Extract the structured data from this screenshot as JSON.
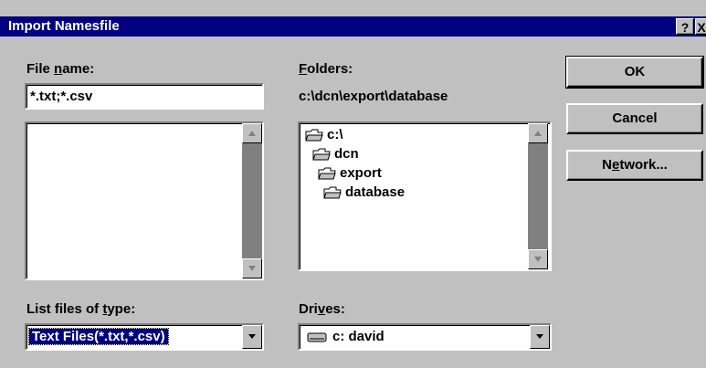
{
  "dialog": {
    "title": "Import Namesfile",
    "help_button": "?",
    "close_button": "X"
  },
  "file_name": {
    "label_pre": "File ",
    "label_accel": "n",
    "label_post": "ame:",
    "value": "*.txt;*.csv"
  },
  "folders": {
    "label_accel": "F",
    "label_post": "olders:",
    "current_path": "c:\\dcn\\export\\database",
    "tree": [
      "c:\\",
      "dcn",
      "export",
      "database"
    ]
  },
  "buttons": {
    "ok": "OK",
    "cancel": "Cancel",
    "network_pre": "N",
    "network_accel": "e",
    "network_post": "twork..."
  },
  "file_type": {
    "label_pre": "List files of ",
    "label_accel": "t",
    "label_post": "ype:",
    "value": "Text Files(*.txt,*.csv)"
  },
  "drives": {
    "label_pre": "Dri",
    "label_accel": "v",
    "label_post": "es:",
    "value": "c: david"
  }
}
